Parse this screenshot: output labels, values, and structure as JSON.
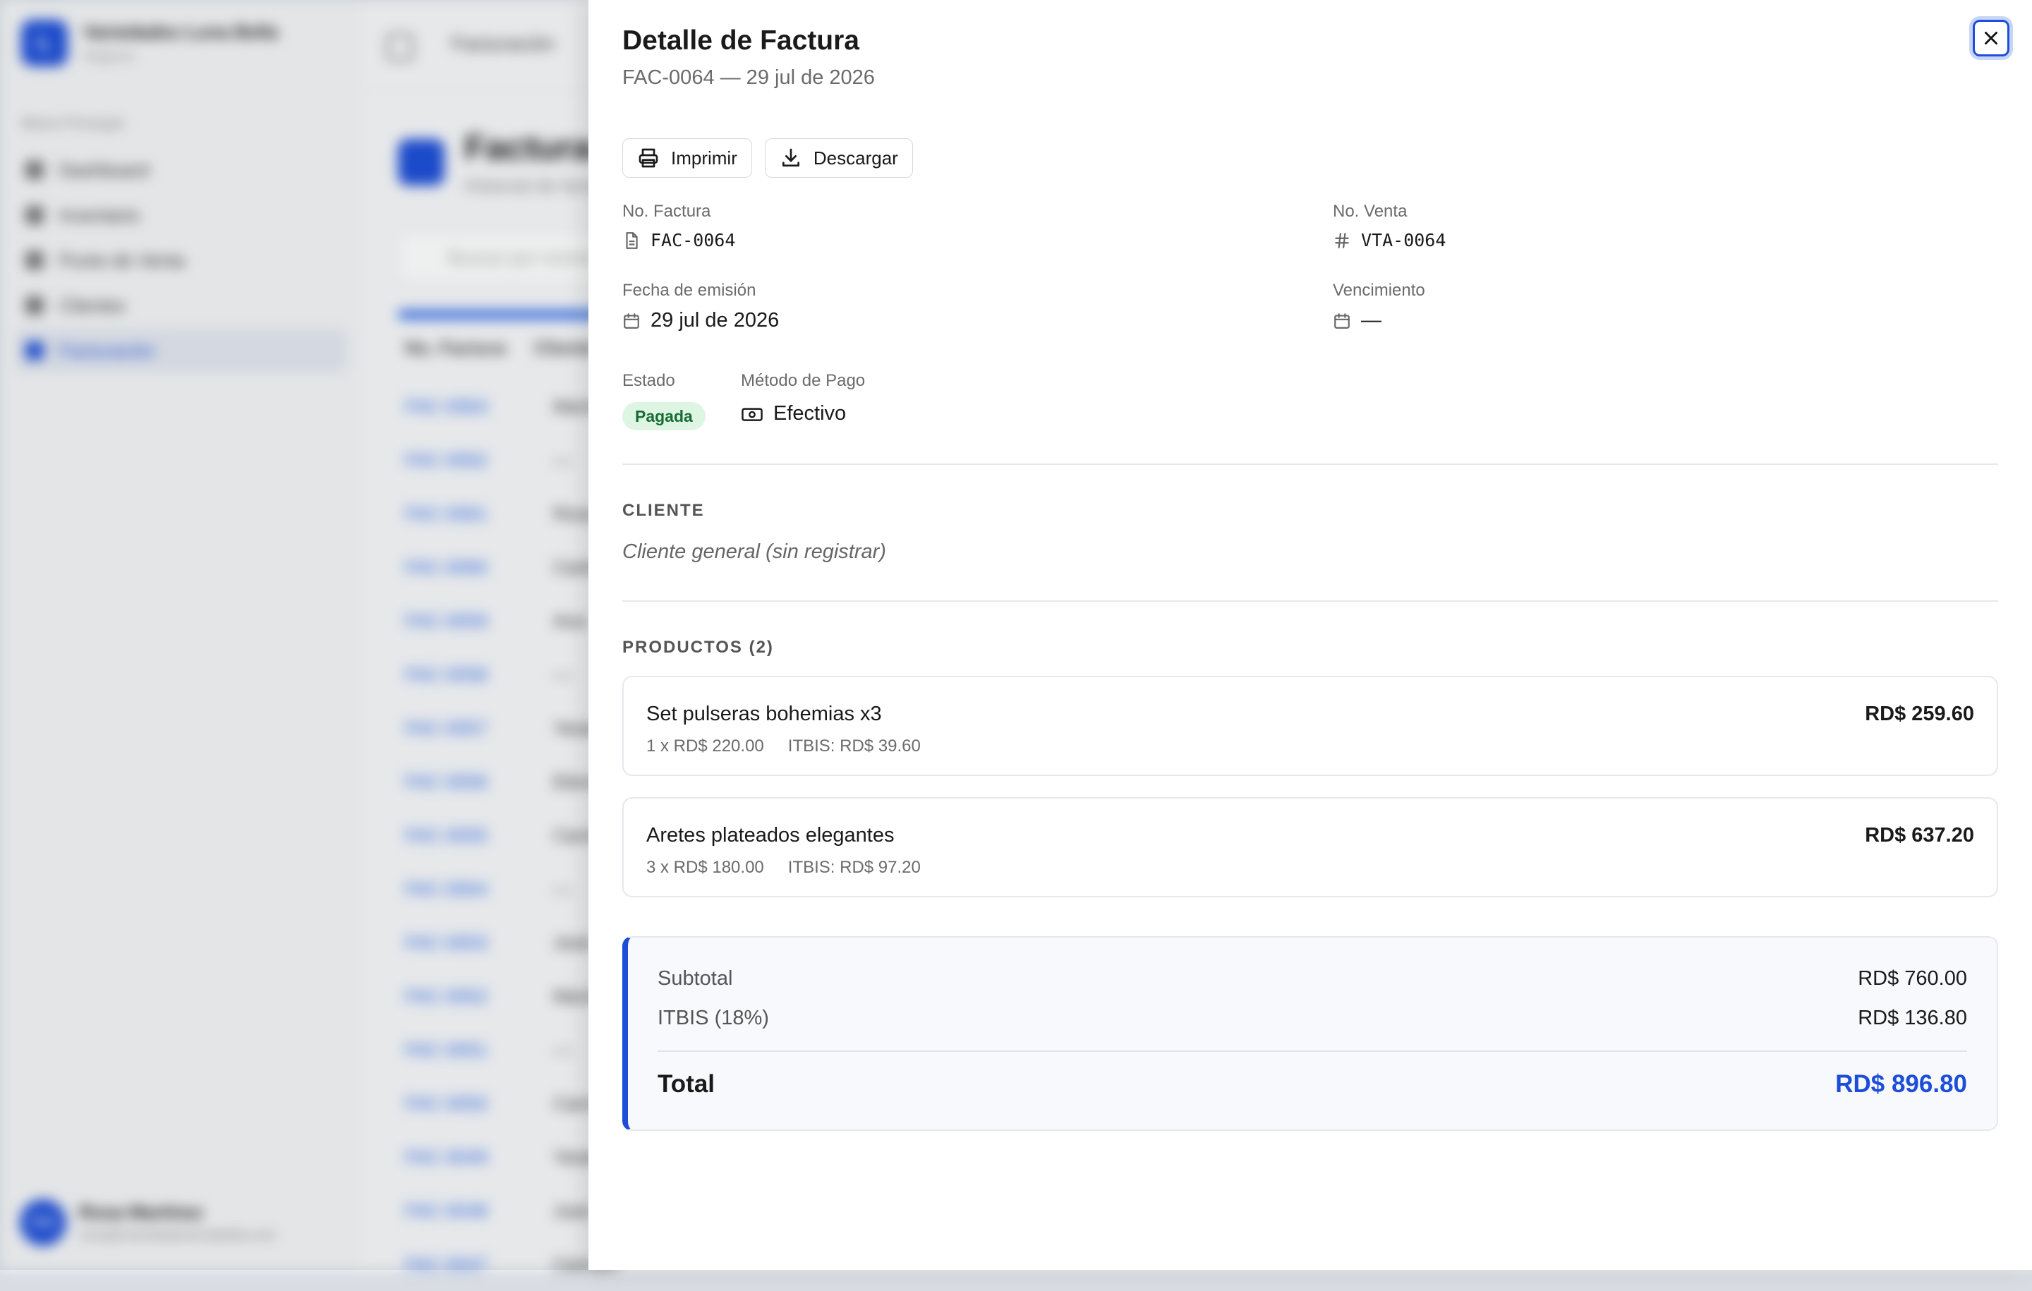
{
  "background": {
    "brand": {
      "name": "Variedades Luna Bella",
      "subtitle": "Negocio",
      "initial": "L"
    },
    "menu_heading": "Menú Principal",
    "menu": [
      "Dashboard",
      "Inventario",
      "Punto de Venta",
      "Clientes",
      "Facturación"
    ],
    "user": {
      "initials": "RM",
      "name": "Rosa Martínez",
      "email": "rosa@variedadeslunabella.com"
    },
    "breadcrumb": "Facturación",
    "page_title": "Facturas",
    "page_subtitle": "Historial de facturas",
    "search_placeholder": "Buscar por número o cliente...",
    "table_headers": [
      "No. Factura",
      "Cliente"
    ],
    "table_rows": [
      [
        "FAC-0063",
        "María"
      ],
      [
        "FAC-0062",
        "—"
      ],
      [
        "FAC-0061",
        "Rosa"
      ],
      [
        "FAC-0060",
        "Carla"
      ],
      [
        "FAC-0059",
        "Ana"
      ],
      [
        "FAC-0058",
        "—"
      ],
      [
        "FAC-0057",
        "Yesenia"
      ],
      [
        "FAC-0056",
        "Elena"
      ],
      [
        "FAC-0055",
        "Carmen"
      ],
      [
        "FAC-0054",
        "—"
      ],
      [
        "FAC-0053",
        "José"
      ],
      [
        "FAC-0052",
        "María"
      ],
      [
        "FAC-0051",
        "—"
      ],
      [
        "FAC-0050",
        "Carmen"
      ],
      [
        "FAC-0049",
        "Yesenia"
      ],
      [
        "FAC-0048",
        "Juan"
      ],
      [
        "FAC-0047",
        "Carmen"
      ]
    ]
  },
  "drawer": {
    "title": "Detalle de Factura",
    "subtitle": "FAC-0064 — 29 jul de 2026",
    "buttons": {
      "print": "Imprimir",
      "download": "Descargar"
    },
    "fields": {
      "invoice_no_label": "No. Factura",
      "invoice_no": "FAC-0064",
      "sale_no_label": "No. Venta",
      "sale_no": "VTA-0064",
      "issue_date_label": "Fecha de emisión",
      "issue_date": "29 jul de 2026",
      "due_label": "Vencimiento",
      "due": "—",
      "status_label": "Estado",
      "status": "Pagada",
      "payment_label": "Método de Pago",
      "payment": "Efectivo"
    },
    "client": {
      "heading": "CLIENTE",
      "value": "Cliente general (sin registrar)"
    },
    "products": {
      "heading": "PRODUCTOS (2)",
      "items": [
        {
          "name": "Set pulseras bohemias x3",
          "qty_price": "1 x RD$ 220.00",
          "tax": "ITBIS: RD$ 39.60",
          "total": "RD$ 259.60"
        },
        {
          "name": "Aretes plateados elegantes",
          "qty_price": "3 x RD$ 180.00",
          "tax": "ITBIS: RD$ 97.20",
          "total": "RD$ 637.20"
        }
      ]
    },
    "totals": {
      "subtotal_label": "Subtotal",
      "subtotal": "RD$ 760.00",
      "tax_label": "ITBIS (18%)",
      "tax": "RD$ 136.80",
      "total_label": "Total",
      "total": "RD$ 896.80"
    }
  },
  "colors": {
    "accent": "#1d4ed8",
    "badge_bg": "#dff5e4",
    "badge_text": "#186c33"
  },
  "icons": [
    "close-icon",
    "printer-icon",
    "download-icon",
    "file-icon",
    "hash-icon",
    "calendar-icon",
    "banknote-icon"
  ]
}
